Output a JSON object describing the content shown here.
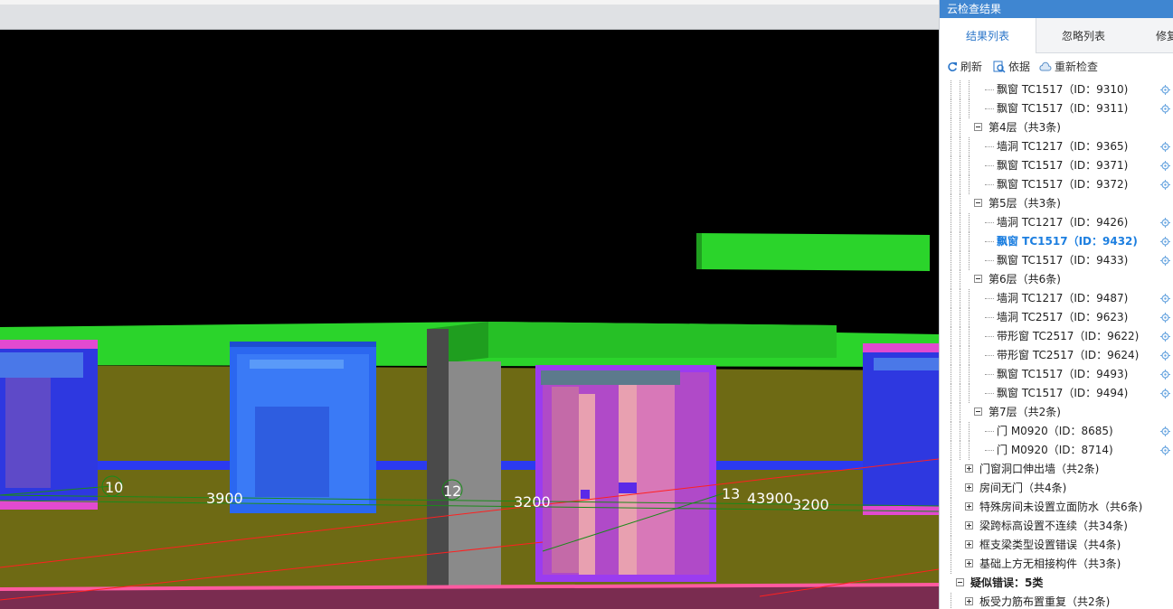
{
  "viewport": {
    "grid_labels": [
      "10",
      "12",
      "13"
    ],
    "dimension_labels": [
      "3900",
      "3200",
      "43900",
      "3200"
    ]
  },
  "panel": {
    "title": "云检查结果",
    "tabs": [
      {
        "label": "结果列表",
        "active": true
      },
      {
        "label": "忽略列表",
        "active": false
      },
      {
        "label": "修复",
        "active": false
      }
    ],
    "toolbar": {
      "refresh": "刷新",
      "basis": "依据",
      "recheck": "重新检查"
    }
  },
  "tree": [
    {
      "label": "飘窗 TC1517（ID：9310)",
      "level": 3
    },
    {
      "label": "飘窗 TC1517（ID：9311)",
      "level": 3
    },
    {
      "label": "第4层（共3条)",
      "level": 2,
      "toggle": "minus"
    },
    {
      "label": "墙洞 TC1217（ID：9365)",
      "level": 3
    },
    {
      "label": "飘窗 TC1517（ID：9371)",
      "level": 3
    },
    {
      "label": "飘窗 TC1517（ID：9372)",
      "level": 3
    },
    {
      "label": "第5层（共3条)",
      "level": 2,
      "toggle": "minus"
    },
    {
      "label": "墙洞 TC1217（ID：9426)",
      "level": 3
    },
    {
      "label": "飘窗 TC1517（ID：9432)",
      "level": 3,
      "selected": true
    },
    {
      "label": "飘窗 TC1517（ID：9433)",
      "level": 3
    },
    {
      "label": "第6层（共6条)",
      "level": 2,
      "toggle": "minus"
    },
    {
      "label": "墙洞 TC1217（ID：9487)",
      "level": 3
    },
    {
      "label": "墙洞 TC2517（ID：9623)",
      "level": 3
    },
    {
      "label": "带形窗 TC2517（ID：9622)",
      "level": 3
    },
    {
      "label": "带形窗 TC2517（ID：9624)",
      "level": 3
    },
    {
      "label": "飘窗 TC1517（ID：9493)",
      "level": 3
    },
    {
      "label": "飘窗 TC1517（ID：9494)",
      "level": 3
    },
    {
      "label": "第7层（共2条)",
      "level": 2,
      "toggle": "minus"
    },
    {
      "label": "门 M0920（ID：8685)",
      "level": 3
    },
    {
      "label": "门 M0920（ID：8714)",
      "level": 3
    },
    {
      "label": "门窗洞口伸出墙（共2条)",
      "level": 1,
      "toggle": "plus"
    },
    {
      "label": "房间无门（共4条)",
      "level": 1,
      "toggle": "plus"
    },
    {
      "label": "特殊房间未设置立面防水（共6条)",
      "level": 1,
      "toggle": "plus"
    },
    {
      "label": "梁跨标高设置不连续（共34条)",
      "level": 1,
      "toggle": "plus"
    },
    {
      "label": "框支梁类型设置错误（共4条)",
      "level": 1,
      "toggle": "plus"
    },
    {
      "label": "基础上方无相接构件（共3条)",
      "level": 1,
      "toggle": "plus"
    },
    {
      "label": "疑似错误：5类",
      "level": 0,
      "toggle": "minus",
      "bold": true
    },
    {
      "label": "板受力筋布置重复（共2条)",
      "level": 1,
      "toggle": "plus"
    }
  ],
  "colors": {
    "accent": "#3f86d1",
    "selected_text": "#1d7fe0",
    "slab_green": "#2bd42b",
    "wall_olive": "#6e6a14",
    "window_blue": "#2b67f0",
    "window_purple": "#9b3cf0",
    "floor_pink": "#e0408a"
  }
}
